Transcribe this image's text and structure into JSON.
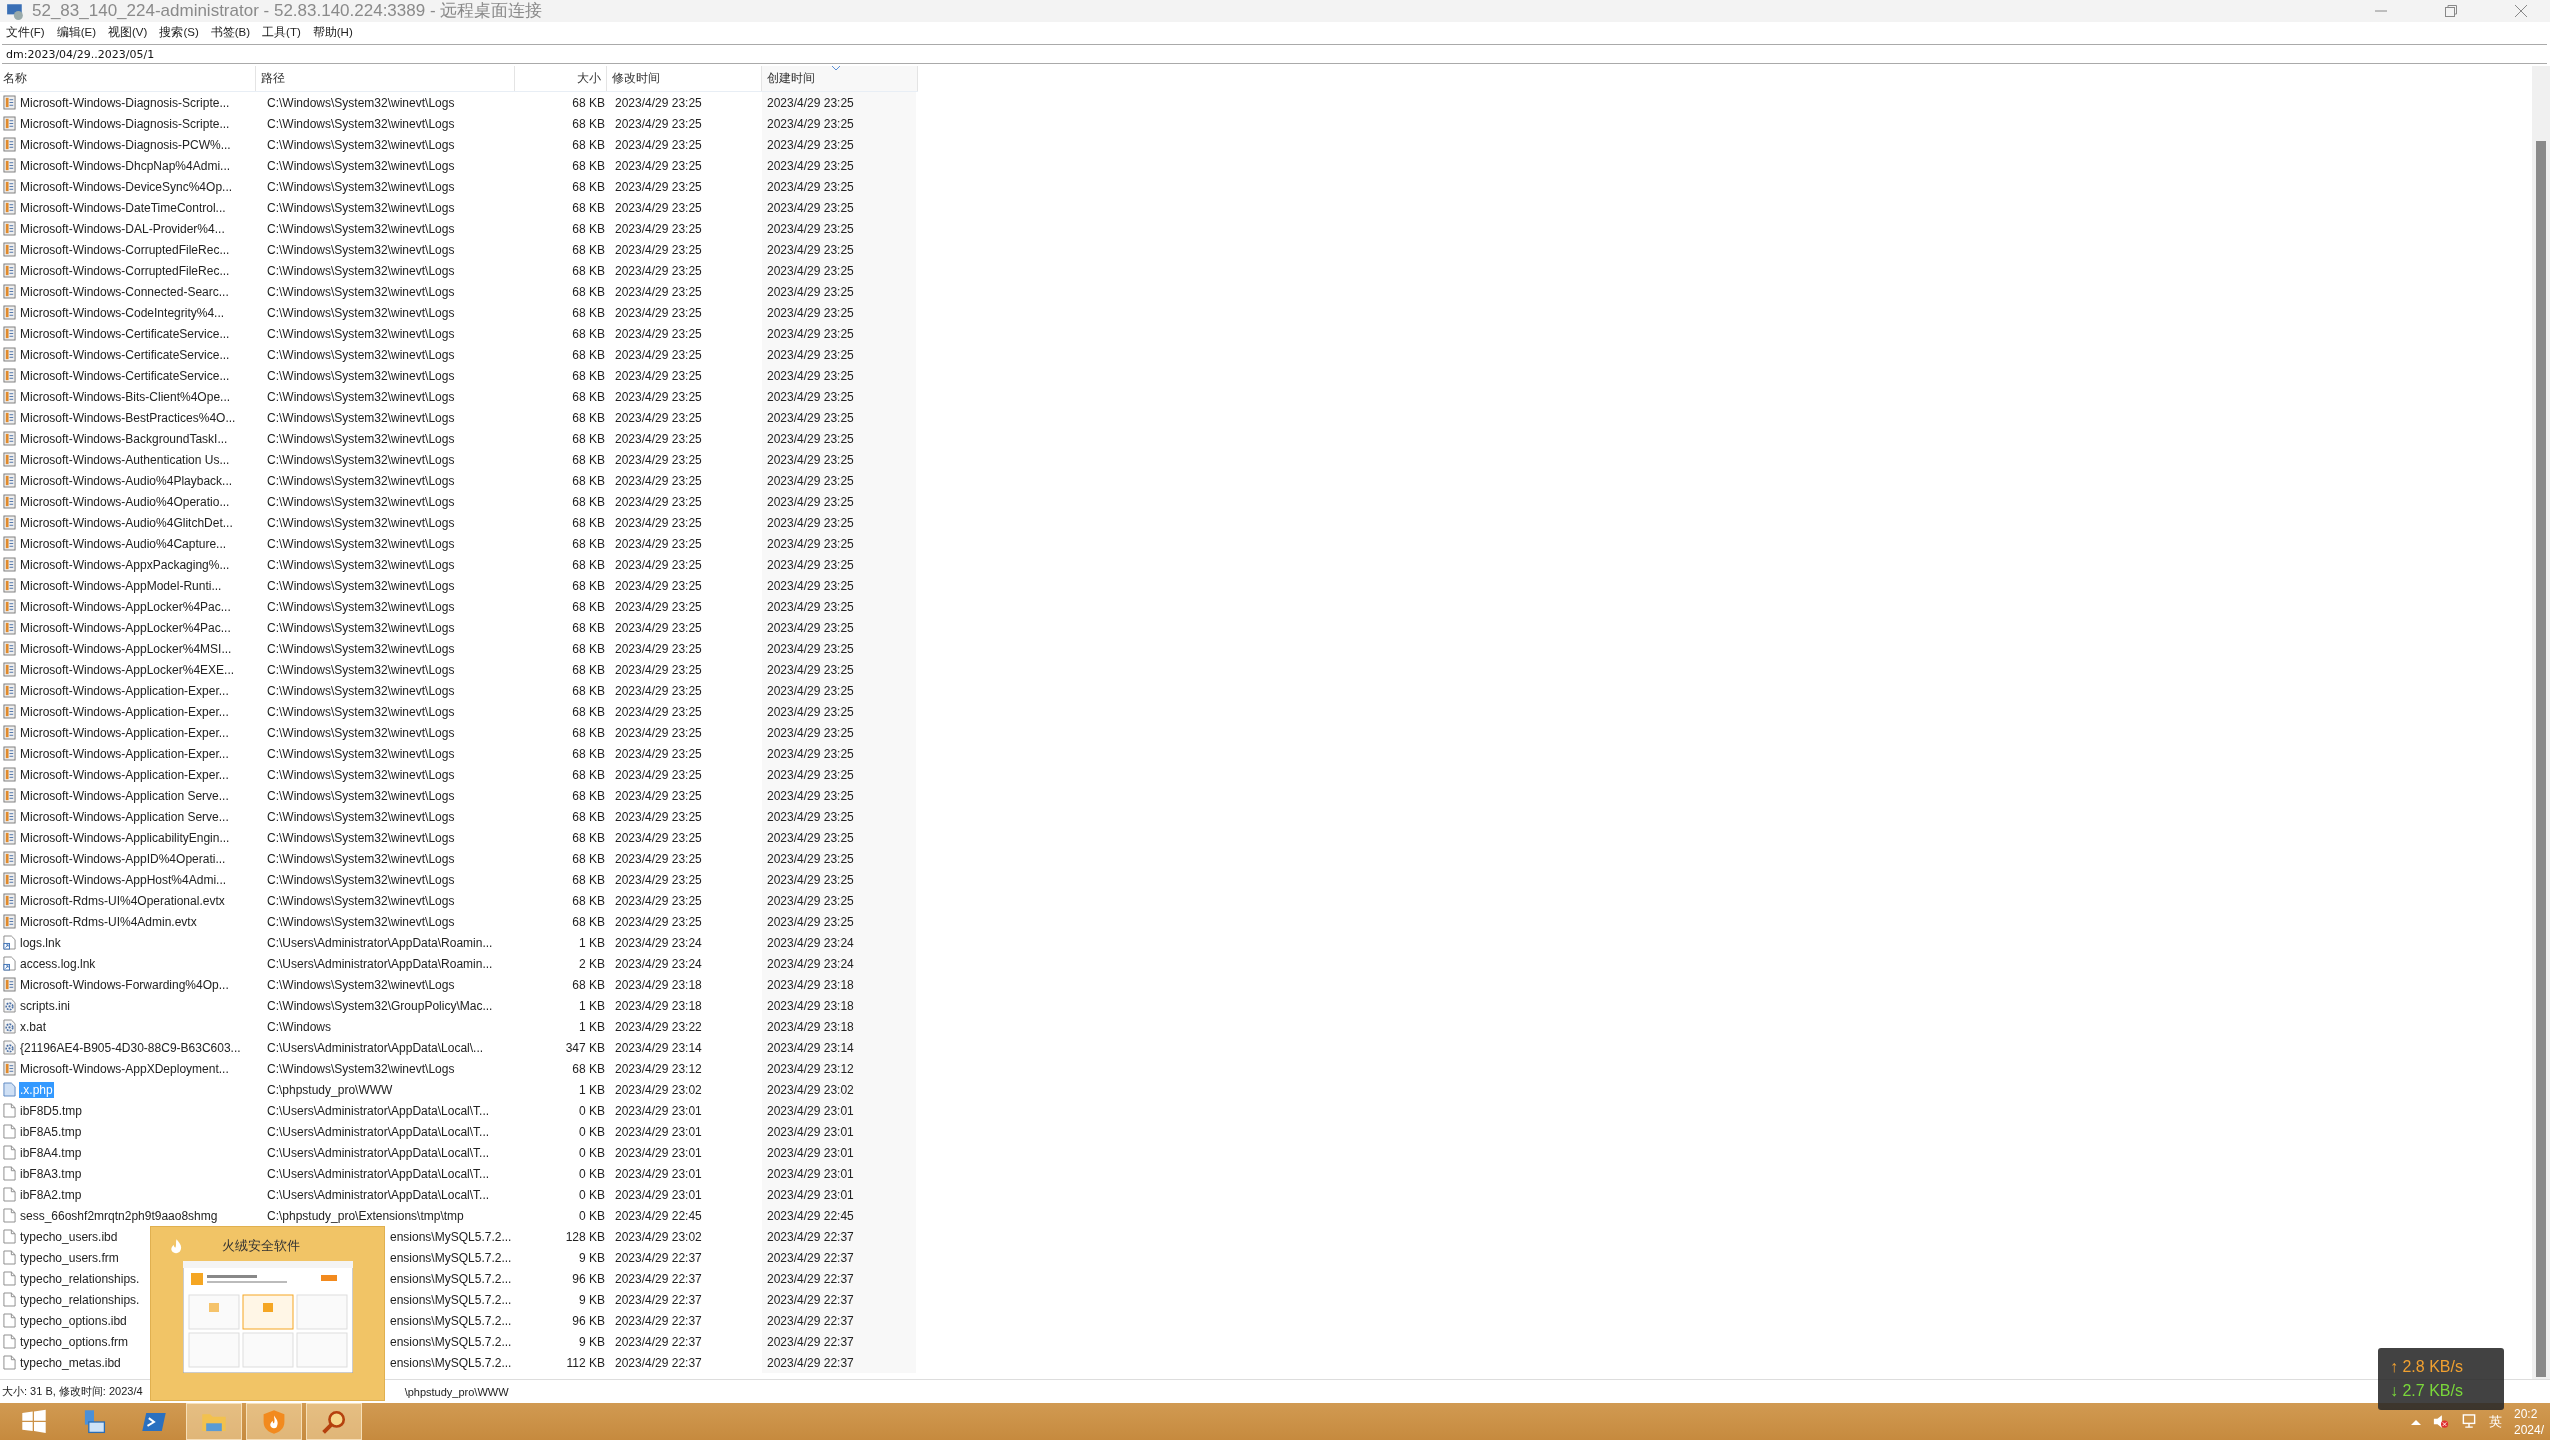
{
  "window": {
    "title": "52_83_140_224-administrator - 52.83.140.224:3389 - 远程桌面连接"
  },
  "menu": [
    "文件(F)",
    "编辑(E)",
    "视图(V)",
    "搜索(S)",
    "书签(B)",
    "工具(T)",
    "帮助(H)"
  ],
  "search": {
    "value": "dm:2023/04/29..2023/05/1"
  },
  "columns": [
    {
      "label": "名称",
      "sorted": false
    },
    {
      "label": "路径",
      "sorted": false
    },
    {
      "label": "大小",
      "sorted": false
    },
    {
      "label": "修改时间",
      "sorted": false
    },
    {
      "label": "创建时间",
      "sorted": true
    }
  ],
  "rows": [
    {
      "kind": "log",
      "name": "Microsoft-Windows-Diagnosis-Scripte...",
      "path": "C:\\Windows\\System32\\winevt\\Logs",
      "size": "68 KB",
      "modified": "2023/4/29 23:25",
      "created": "2023/4/29 23:25",
      "selected": false
    },
    {
      "kind": "log",
      "name": "Microsoft-Windows-Diagnosis-Scripte...",
      "path": "C:\\Windows\\System32\\winevt\\Logs",
      "size": "68 KB",
      "modified": "2023/4/29 23:25",
      "created": "2023/4/29 23:25",
      "selected": false
    },
    {
      "kind": "log",
      "name": "Microsoft-Windows-Diagnosis-PCW%...",
      "path": "C:\\Windows\\System32\\winevt\\Logs",
      "size": "68 KB",
      "modified": "2023/4/29 23:25",
      "created": "2023/4/29 23:25",
      "selected": false
    },
    {
      "kind": "log",
      "name": "Microsoft-Windows-DhcpNap%4Admi...",
      "path": "C:\\Windows\\System32\\winevt\\Logs",
      "size": "68 KB",
      "modified": "2023/4/29 23:25",
      "created": "2023/4/29 23:25",
      "selected": false
    },
    {
      "kind": "log",
      "name": "Microsoft-Windows-DeviceSync%4Op...",
      "path": "C:\\Windows\\System32\\winevt\\Logs",
      "size": "68 KB",
      "modified": "2023/4/29 23:25",
      "created": "2023/4/29 23:25",
      "selected": false
    },
    {
      "kind": "log",
      "name": "Microsoft-Windows-DateTimeControl...",
      "path": "C:\\Windows\\System32\\winevt\\Logs",
      "size": "68 KB",
      "modified": "2023/4/29 23:25",
      "created": "2023/4/29 23:25",
      "selected": false
    },
    {
      "kind": "log",
      "name": "Microsoft-Windows-DAL-Provider%4...",
      "path": "C:\\Windows\\System32\\winevt\\Logs",
      "size": "68 KB",
      "modified": "2023/4/29 23:25",
      "created": "2023/4/29 23:25",
      "selected": false
    },
    {
      "kind": "log",
      "name": "Microsoft-Windows-CorruptedFileRec...",
      "path": "C:\\Windows\\System32\\winevt\\Logs",
      "size": "68 KB",
      "modified": "2023/4/29 23:25",
      "created": "2023/4/29 23:25",
      "selected": false
    },
    {
      "kind": "log",
      "name": "Microsoft-Windows-CorruptedFileRec...",
      "path": "C:\\Windows\\System32\\winevt\\Logs",
      "size": "68 KB",
      "modified": "2023/4/29 23:25",
      "created": "2023/4/29 23:25",
      "selected": false
    },
    {
      "kind": "log",
      "name": "Microsoft-Windows-Connected-Searc...",
      "path": "C:\\Windows\\System32\\winevt\\Logs",
      "size": "68 KB",
      "modified": "2023/4/29 23:25",
      "created": "2023/4/29 23:25",
      "selected": false
    },
    {
      "kind": "log",
      "name": "Microsoft-Windows-CodeIntegrity%4...",
      "path": "C:\\Windows\\System32\\winevt\\Logs",
      "size": "68 KB",
      "modified": "2023/4/29 23:25",
      "created": "2023/4/29 23:25",
      "selected": false
    },
    {
      "kind": "log",
      "name": "Microsoft-Windows-CertificateService...",
      "path": "C:\\Windows\\System32\\winevt\\Logs",
      "size": "68 KB",
      "modified": "2023/4/29 23:25",
      "created": "2023/4/29 23:25",
      "selected": false
    },
    {
      "kind": "log",
      "name": "Microsoft-Windows-CertificateService...",
      "path": "C:\\Windows\\System32\\winevt\\Logs",
      "size": "68 KB",
      "modified": "2023/4/29 23:25",
      "created": "2023/4/29 23:25",
      "selected": false
    },
    {
      "kind": "log",
      "name": "Microsoft-Windows-CertificateService...",
      "path": "C:\\Windows\\System32\\winevt\\Logs",
      "size": "68 KB",
      "modified": "2023/4/29 23:25",
      "created": "2023/4/29 23:25",
      "selected": false
    },
    {
      "kind": "log",
      "name": "Microsoft-Windows-Bits-Client%4Ope...",
      "path": "C:\\Windows\\System32\\winevt\\Logs",
      "size": "68 KB",
      "modified": "2023/4/29 23:25",
      "created": "2023/4/29 23:25",
      "selected": false
    },
    {
      "kind": "log",
      "name": "Microsoft-Windows-BestPractices%4O...",
      "path": "C:\\Windows\\System32\\winevt\\Logs",
      "size": "68 KB",
      "modified": "2023/4/29 23:25",
      "created": "2023/4/29 23:25",
      "selected": false
    },
    {
      "kind": "log",
      "name": "Microsoft-Windows-BackgroundTaskI...",
      "path": "C:\\Windows\\System32\\winevt\\Logs",
      "size": "68 KB",
      "modified": "2023/4/29 23:25",
      "created": "2023/4/29 23:25",
      "selected": false
    },
    {
      "kind": "log",
      "name": "Microsoft-Windows-Authentication Us...",
      "path": "C:\\Windows\\System32\\winevt\\Logs",
      "size": "68 KB",
      "modified": "2023/4/29 23:25",
      "created": "2023/4/29 23:25",
      "selected": false
    },
    {
      "kind": "log",
      "name": "Microsoft-Windows-Audio%4Playback...",
      "path": "C:\\Windows\\System32\\winevt\\Logs",
      "size": "68 KB",
      "modified": "2023/4/29 23:25",
      "created": "2023/4/29 23:25",
      "selected": false
    },
    {
      "kind": "log",
      "name": "Microsoft-Windows-Audio%4Operatio...",
      "path": "C:\\Windows\\System32\\winevt\\Logs",
      "size": "68 KB",
      "modified": "2023/4/29 23:25",
      "created": "2023/4/29 23:25",
      "selected": false
    },
    {
      "kind": "log",
      "name": "Microsoft-Windows-Audio%4GlitchDet...",
      "path": "C:\\Windows\\System32\\winevt\\Logs",
      "size": "68 KB",
      "modified": "2023/4/29 23:25",
      "created": "2023/4/29 23:25",
      "selected": false
    },
    {
      "kind": "log",
      "name": "Microsoft-Windows-Audio%4Capture...",
      "path": "C:\\Windows\\System32\\winevt\\Logs",
      "size": "68 KB",
      "modified": "2023/4/29 23:25",
      "created": "2023/4/29 23:25",
      "selected": false
    },
    {
      "kind": "log",
      "name": "Microsoft-Windows-AppxPackaging%...",
      "path": "C:\\Windows\\System32\\winevt\\Logs",
      "size": "68 KB",
      "modified": "2023/4/29 23:25",
      "created": "2023/4/29 23:25",
      "selected": false
    },
    {
      "kind": "log",
      "name": "Microsoft-Windows-AppModel-Runti...",
      "path": "C:\\Windows\\System32\\winevt\\Logs",
      "size": "68 KB",
      "modified": "2023/4/29 23:25",
      "created": "2023/4/29 23:25",
      "selected": false
    },
    {
      "kind": "log",
      "name": "Microsoft-Windows-AppLocker%4Pac...",
      "path": "C:\\Windows\\System32\\winevt\\Logs",
      "size": "68 KB",
      "modified": "2023/4/29 23:25",
      "created": "2023/4/29 23:25",
      "selected": false
    },
    {
      "kind": "log",
      "name": "Microsoft-Windows-AppLocker%4Pac...",
      "path": "C:\\Windows\\System32\\winevt\\Logs",
      "size": "68 KB",
      "modified": "2023/4/29 23:25",
      "created": "2023/4/29 23:25",
      "selected": false
    },
    {
      "kind": "log",
      "name": "Microsoft-Windows-AppLocker%4MSI...",
      "path": "C:\\Windows\\System32\\winevt\\Logs",
      "size": "68 KB",
      "modified": "2023/4/29 23:25",
      "created": "2023/4/29 23:25",
      "selected": false
    },
    {
      "kind": "log",
      "name": "Microsoft-Windows-AppLocker%4EXE...",
      "path": "C:\\Windows\\System32\\winevt\\Logs",
      "size": "68 KB",
      "modified": "2023/4/29 23:25",
      "created": "2023/4/29 23:25",
      "selected": false
    },
    {
      "kind": "log",
      "name": "Microsoft-Windows-Application-Exper...",
      "path": "C:\\Windows\\System32\\winevt\\Logs",
      "size": "68 KB",
      "modified": "2023/4/29 23:25",
      "created": "2023/4/29 23:25",
      "selected": false
    },
    {
      "kind": "log",
      "name": "Microsoft-Windows-Application-Exper...",
      "path": "C:\\Windows\\System32\\winevt\\Logs",
      "size": "68 KB",
      "modified": "2023/4/29 23:25",
      "created": "2023/4/29 23:25",
      "selected": false
    },
    {
      "kind": "log",
      "name": "Microsoft-Windows-Application-Exper...",
      "path": "C:\\Windows\\System32\\winevt\\Logs",
      "size": "68 KB",
      "modified": "2023/4/29 23:25",
      "created": "2023/4/29 23:25",
      "selected": false
    },
    {
      "kind": "log",
      "name": "Microsoft-Windows-Application-Exper...",
      "path": "C:\\Windows\\System32\\winevt\\Logs",
      "size": "68 KB",
      "modified": "2023/4/29 23:25",
      "created": "2023/4/29 23:25",
      "selected": false
    },
    {
      "kind": "log",
      "name": "Microsoft-Windows-Application-Exper...",
      "path": "C:\\Windows\\System32\\winevt\\Logs",
      "size": "68 KB",
      "modified": "2023/4/29 23:25",
      "created": "2023/4/29 23:25",
      "selected": false
    },
    {
      "kind": "log",
      "name": "Microsoft-Windows-Application Serve...",
      "path": "C:\\Windows\\System32\\winevt\\Logs",
      "size": "68 KB",
      "modified": "2023/4/29 23:25",
      "created": "2023/4/29 23:25",
      "selected": false
    },
    {
      "kind": "log",
      "name": "Microsoft-Windows-Application Serve...",
      "path": "C:\\Windows\\System32\\winevt\\Logs",
      "size": "68 KB",
      "modified": "2023/4/29 23:25",
      "created": "2023/4/29 23:25",
      "selected": false
    },
    {
      "kind": "log",
      "name": "Microsoft-Windows-ApplicabilityEngin...",
      "path": "C:\\Windows\\System32\\winevt\\Logs",
      "size": "68 KB",
      "modified": "2023/4/29 23:25",
      "created": "2023/4/29 23:25",
      "selected": false
    },
    {
      "kind": "log",
      "name": "Microsoft-Windows-AppID%4Operati...",
      "path": "C:\\Windows\\System32\\winevt\\Logs",
      "size": "68 KB",
      "modified": "2023/4/29 23:25",
      "created": "2023/4/29 23:25",
      "selected": false
    },
    {
      "kind": "log",
      "name": "Microsoft-Windows-AppHost%4Admi...",
      "path": "C:\\Windows\\System32\\winevt\\Logs",
      "size": "68 KB",
      "modified": "2023/4/29 23:25",
      "created": "2023/4/29 23:25",
      "selected": false
    },
    {
      "kind": "log",
      "name": "Microsoft-Rdms-UI%4Operational.evtx",
      "path": "C:\\Windows\\System32\\winevt\\Logs",
      "size": "68 KB",
      "modified": "2023/4/29 23:25",
      "created": "2023/4/29 23:25",
      "selected": false
    },
    {
      "kind": "log",
      "name": "Microsoft-Rdms-UI%4Admin.evtx",
      "path": "C:\\Windows\\System32\\winevt\\Logs",
      "size": "68 KB",
      "modified": "2023/4/29 23:25",
      "created": "2023/4/29 23:25",
      "selected": false
    },
    {
      "kind": "shortcut",
      "name": "logs.lnk",
      "path": "C:\\Users\\Administrator\\AppData\\Roamin...",
      "size": "1 KB",
      "modified": "2023/4/29 23:24",
      "created": "2023/4/29 23:24",
      "selected": false
    },
    {
      "kind": "shortcut",
      "name": "access.log.lnk",
      "path": "C:\\Users\\Administrator\\AppData\\Roamin...",
      "size": "2 KB",
      "modified": "2023/4/29 23:24",
      "created": "2023/4/29 23:24",
      "selected": false
    },
    {
      "kind": "log",
      "name": "Microsoft-Windows-Forwarding%4Op...",
      "path": "C:\\Windows\\System32\\winevt\\Logs",
      "size": "68 KB",
      "modified": "2023/4/29 23:18",
      "created": "2023/4/29 23:18",
      "selected": false
    },
    {
      "kind": "config",
      "name": "scripts.ini",
      "path": "C:\\Windows\\System32\\GroupPolicy\\Mac...",
      "size": "1 KB",
      "modified": "2023/4/29 23:18",
      "created": "2023/4/29 23:18",
      "selected": false
    },
    {
      "kind": "config",
      "name": "x.bat",
      "path": "C:\\Windows",
      "size": "1 KB",
      "modified": "2023/4/29 23:22",
      "created": "2023/4/29 23:18",
      "selected": false
    },
    {
      "kind": "config",
      "name": "{21196AE4-B905-4D30-88C9-B63C603...",
      "path": "C:\\Users\\Administrator\\AppData\\Local\\...",
      "size": "347 KB",
      "modified": "2023/4/29 23:14",
      "created": "2023/4/29 23:14",
      "selected": false
    },
    {
      "kind": "log",
      "name": "Microsoft-Windows-AppXDeployment...",
      "path": "C:\\Windows\\System32\\winevt\\Logs",
      "size": "68 KB",
      "modified": "2023/4/29 23:12",
      "created": "2023/4/29 23:12",
      "selected": false
    },
    {
      "kind": "php",
      "name": ".x.php",
      "path": "C:\\phpstudy_pro\\WWW",
      "size": "1 KB",
      "modified": "2023/4/29 23:02",
      "created": "2023/4/29 23:02",
      "selected": true
    },
    {
      "kind": "file",
      "name": "ibF8D5.tmp",
      "path": "C:\\Users\\Administrator\\AppData\\Local\\T...",
      "size": "0 KB",
      "modified": "2023/4/29 23:01",
      "created": "2023/4/29 23:01",
      "selected": false
    },
    {
      "kind": "file",
      "name": "ibF8A5.tmp",
      "path": "C:\\Users\\Administrator\\AppData\\Local\\T...",
      "size": "0 KB",
      "modified": "2023/4/29 23:01",
      "created": "2023/4/29 23:01",
      "selected": false
    },
    {
      "kind": "file",
      "name": "ibF8A4.tmp",
      "path": "C:\\Users\\Administrator\\AppData\\Local\\T...",
      "size": "0 KB",
      "modified": "2023/4/29 23:01",
      "created": "2023/4/29 23:01",
      "selected": false
    },
    {
      "kind": "file",
      "name": "ibF8A3.tmp",
      "path": "C:\\Users\\Administrator\\AppData\\Local\\T...",
      "size": "0 KB",
      "modified": "2023/4/29 23:01",
      "created": "2023/4/29 23:01",
      "selected": false
    },
    {
      "kind": "file",
      "name": "ibF8A2.tmp",
      "path": "C:\\Users\\Administrator\\AppData\\Local\\T...",
      "size": "0 KB",
      "modified": "2023/4/29 23:01",
      "created": "2023/4/29 23:01",
      "selected": false
    },
    {
      "kind": "file",
      "name": "sess_66oshf2mrqtn2ph9t9aao8shmg",
      "path": "C:\\phpstudy_pro\\Extensions\\tmp\\tmp",
      "size": "0 KB",
      "modified": "2023/4/29 22:45",
      "created": "2023/4/29 22:45",
      "selected": false
    },
    {
      "kind": "file",
      "name": "typecho_users.ibd",
      "path": "ensions\\MySQL5.7.2...",
      "under_preview": true,
      "size": "128 KB",
      "modified": "2023/4/29 23:02",
      "created": "2023/4/29 22:37",
      "selected": false
    },
    {
      "kind": "file",
      "name": "typecho_users.frm",
      "path": "ensions\\MySQL5.7.2...",
      "under_preview": true,
      "size": "9 KB",
      "modified": "2023/4/29 22:37",
      "created": "2023/4/29 22:37",
      "selected": false
    },
    {
      "kind": "file",
      "name": "typecho_relationships.",
      "path": "ensions\\MySQL5.7.2...",
      "under_preview": true,
      "size": "96 KB",
      "modified": "2023/4/29 22:37",
      "created": "2023/4/29 22:37",
      "selected": false
    },
    {
      "kind": "file",
      "name": "typecho_relationships.",
      "path": "ensions\\MySQL5.7.2...",
      "under_preview": true,
      "size": "9 KB",
      "modified": "2023/4/29 22:37",
      "created": "2023/4/29 22:37",
      "selected": false
    },
    {
      "kind": "file",
      "name": "typecho_options.ibd",
      "path": "ensions\\MySQL5.7.2...",
      "under_preview": true,
      "size": "96 KB",
      "modified": "2023/4/29 22:37",
      "created": "2023/4/29 22:37",
      "selected": false
    },
    {
      "kind": "file",
      "name": "typecho_options.frm",
      "path": "ensions\\MySQL5.7.2...",
      "under_preview": true,
      "size": "9 KB",
      "modified": "2023/4/29 22:37",
      "created": "2023/4/29 22:37",
      "selected": false
    },
    {
      "kind": "file",
      "name": "typecho_metas.ibd",
      "path": "ensions\\MySQL5.7.2...",
      "under_preview": true,
      "size": "112 KB",
      "modified": "2023/4/29 22:37",
      "created": "2023/4/29 22:37",
      "selected": false
    }
  ],
  "status_bar": {
    "left": "大小: 31 B, 修改时间: 2023/4",
    "right": "\\phpstudy_pro\\WWW"
  },
  "preview": {
    "title": "火绒安全软件"
  },
  "taskbar": [
    {
      "kind": "start",
      "active": false
    },
    {
      "kind": "server",
      "active": false
    },
    {
      "kind": "powershell",
      "active": false
    },
    {
      "kind": "folder",
      "active": true
    },
    {
      "kind": "flame",
      "active": true
    },
    {
      "kind": "magnifier",
      "active": true
    }
  ],
  "netspeed": [
    "↑ 2.8 KB/s",
    "↓ 2.7 KB/s"
  ],
  "tray": {
    "ime": "英",
    "time": "20:2",
    "date": "2024/"
  }
}
